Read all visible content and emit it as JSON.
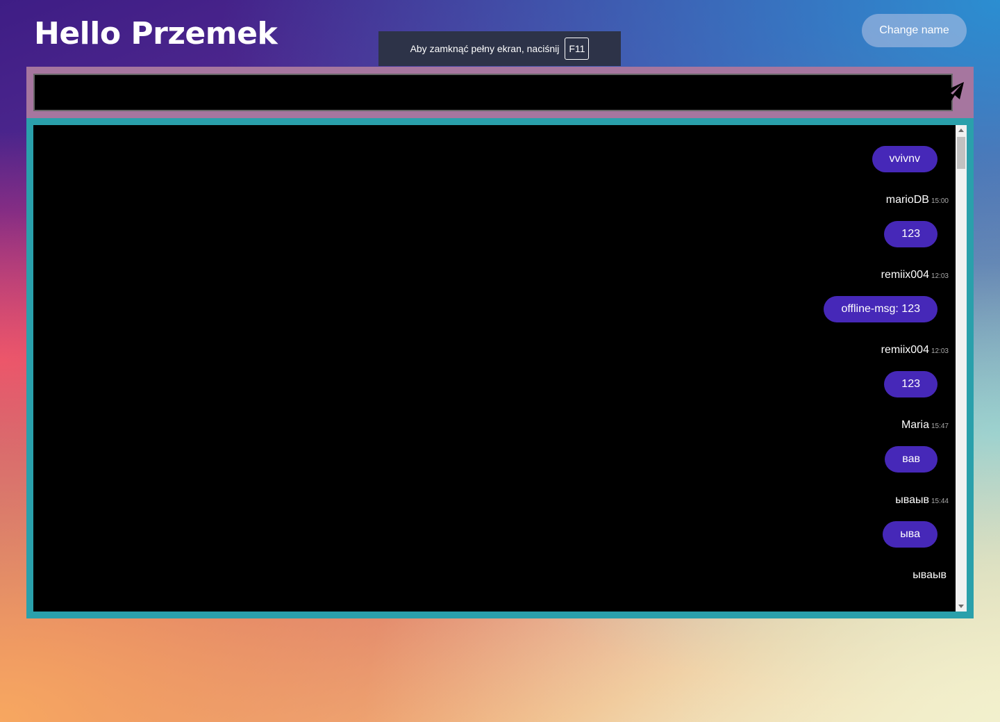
{
  "header": {
    "greeting": "Hello Przemek",
    "change_name_label": "Change name"
  },
  "fullscreen_notice": {
    "text": "Aby zamknąć pełny ekran, naciśnij",
    "key": "F11"
  },
  "composer": {
    "value": "",
    "send_icon": "paper-plane-icon"
  },
  "chat": {
    "messages": [
      {
        "text": "vvivnv",
        "author": "marioDB",
        "time": "15:00"
      },
      {
        "text": "123",
        "author": "remiix004",
        "time": "12:03"
      },
      {
        "text": "offline-msg: 123",
        "author": "remiix004",
        "time": "12:03"
      },
      {
        "text": "123",
        "author": "Maria",
        "time": "15:47"
      },
      {
        "text": "вав",
        "author": "ываыв",
        "time": "15:44"
      },
      {
        "text": "ыва",
        "author": "ываыв",
        "time": ""
      }
    ]
  },
  "colors": {
    "bubble": "#4628b8",
    "composer_bar": "#a6769f",
    "chat_frame": "#2aa0ab"
  }
}
